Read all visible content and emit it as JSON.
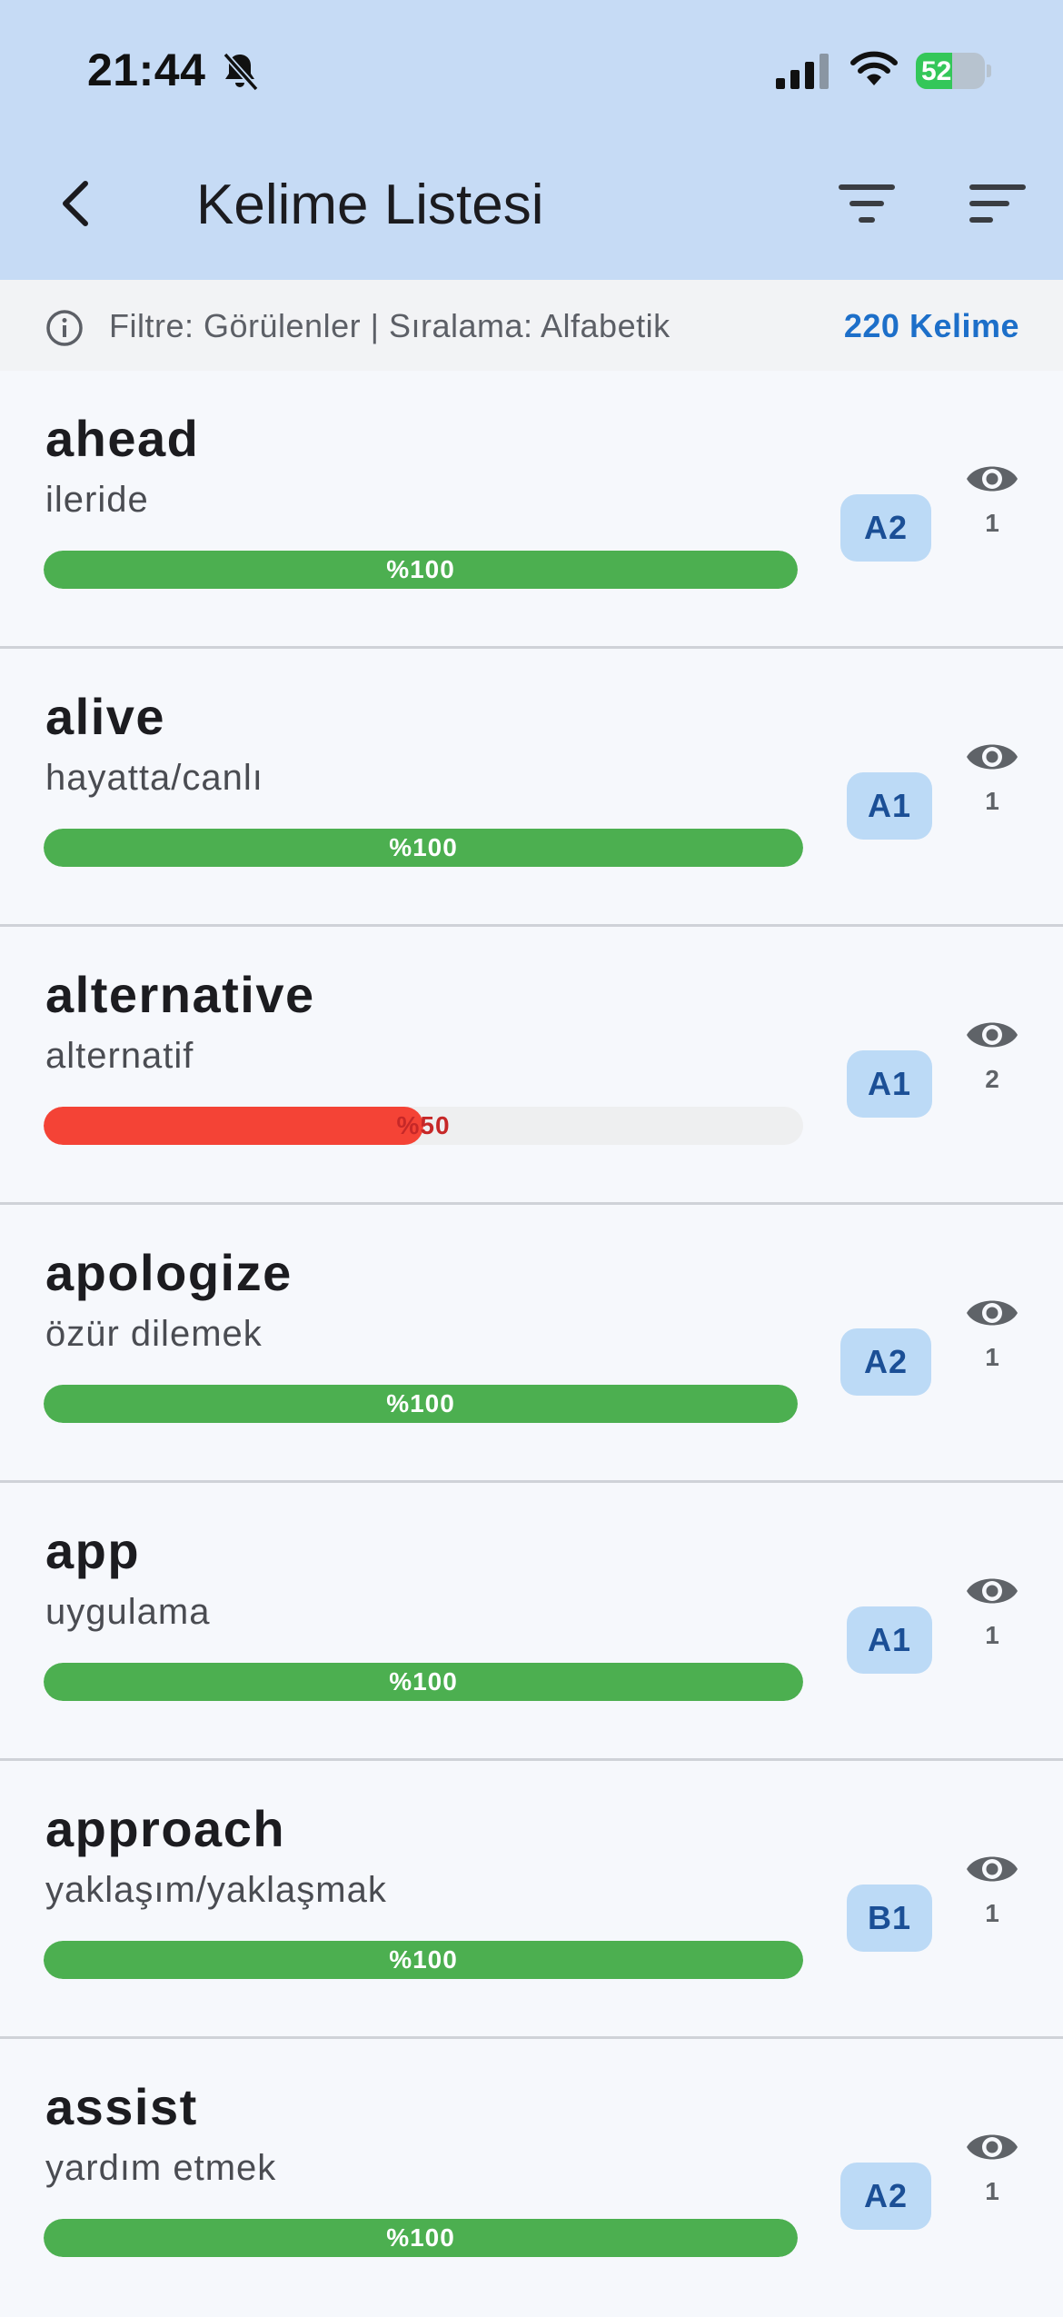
{
  "status_bar": {
    "time": "21:44",
    "battery": "52"
  },
  "header": {
    "title": "Kelime Listesi"
  },
  "info_bar": {
    "filter_text": "Filtre: Görülenler  |  Sıralama: Alfabetik",
    "count_text": "220 Kelime"
  },
  "colors": {
    "header_bg": "#c6dbf5",
    "progress_full": "#4caf50",
    "progress_low": "#f44336",
    "badge_bg": "#bcdaf6",
    "badge_text": "#1b4f96",
    "accent": "#1d6fc9"
  },
  "words": [
    {
      "word": "ahead",
      "meaning": "ileride",
      "level": "A2",
      "progress": 100,
      "progress_label": "%100",
      "views": "1"
    },
    {
      "word": "alive",
      "meaning": "hayatta/canlı",
      "level": "A1",
      "progress": 100,
      "progress_label": "%100",
      "views": "1"
    },
    {
      "word": "alternative",
      "meaning": "alternatif",
      "level": "A1",
      "progress": 50,
      "progress_label": "%50",
      "views": "2"
    },
    {
      "word": "apologize",
      "meaning": "özür dilemek",
      "level": "A2",
      "progress": 100,
      "progress_label": "%100",
      "views": "1"
    },
    {
      "word": "app",
      "meaning": "uygulama",
      "level": "A1",
      "progress": 100,
      "progress_label": "%100",
      "views": "1"
    },
    {
      "word": "approach",
      "meaning": "yaklaşım/yaklaşmak",
      "level": "B1",
      "progress": 100,
      "progress_label": "%100",
      "views": "1"
    },
    {
      "word": "assist",
      "meaning": "yardım etmek",
      "level": "A2",
      "progress": 100,
      "progress_label": "%100",
      "views": "1"
    }
  ]
}
